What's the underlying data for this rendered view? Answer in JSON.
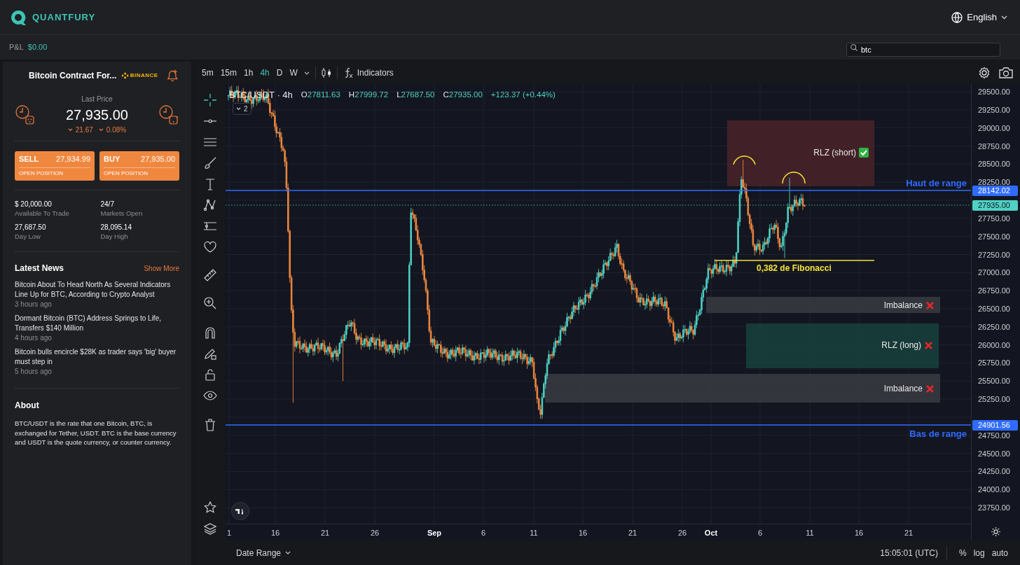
{
  "header": {
    "brand": "QUANTFURY",
    "language": "English"
  },
  "pnl": {
    "label": "P&L",
    "value": "$0.00"
  },
  "search": {
    "value": "btc"
  },
  "instrument": {
    "name": "Bitcoin Contract For...",
    "exchange": "BINANCE",
    "price_label": "Last Price",
    "price": "27,935.00",
    "change": "21.67",
    "change_pct": "0.08%",
    "falling": true
  },
  "trade_buttons": [
    {
      "label": "SELL",
      "price": "27,934.99",
      "action": "OPEN POSITION"
    },
    {
      "label": "BUY",
      "price": "27,935.00",
      "action": "OPEN POSITION"
    }
  ],
  "stats": [
    {
      "value": "$ 20,000.00",
      "label": "Available To Trade"
    },
    {
      "value": "24/7",
      "label": "Markets Open"
    },
    {
      "value": "27,687.50",
      "label": "Day Low"
    },
    {
      "value": "28,095.14",
      "label": "Day High"
    }
  ],
  "news": {
    "title": "Latest News",
    "more": "Show More",
    "items": [
      {
        "headline": "Bitcoin About To Head North As Several Indicators Line Up for BTC, According to Crypto Analyst",
        "time": "3 hours ago"
      },
      {
        "headline": "Dormant Bitcoin (BTC) Address Springs to Life, Transfers $140 Million",
        "time": "4 hours ago"
      },
      {
        "headline": "Bitcoin bulls encircle $28K as trader says 'big' buyer must step in",
        "time": "5 hours ago"
      }
    ]
  },
  "about": {
    "title": "About",
    "text": "BTC/USDT is the rate that one Bitcoin, BTC, is exchanged for Tether, USDT. BTC is the base currency and USDT is the quote currency, or counter currency."
  },
  "toolbar": {
    "timeframes": [
      {
        "label": "5m",
        "selected": false
      },
      {
        "label": "15m",
        "selected": false
      },
      {
        "label": "1h",
        "selected": false
      },
      {
        "label": "4h",
        "selected": true
      },
      {
        "label": "D",
        "selected": false
      },
      {
        "label": "W",
        "selected": false
      }
    ],
    "indicators": "Indicators"
  },
  "legend": {
    "symbol": "BTC/USDT · 4h",
    "ohlc": [
      {
        "key": "O",
        "value": "27811.63"
      },
      {
        "key": "H",
        "value": "27999.72"
      },
      {
        "key": "L",
        "value": "27687.50"
      },
      {
        "key": "C",
        "value": "27935.00"
      }
    ],
    "change": "+123.37 (+0.44%)",
    "collapsed_count": "2"
  },
  "annotations": [
    {
      "kind": "zone_short",
      "label": "RLZ (short)",
      "confirmed": true
    },
    {
      "kind": "range_line",
      "label": "Haut de range"
    },
    {
      "kind": "fib_line",
      "label": "0,382 de Fibonacci"
    },
    {
      "kind": "imbalance",
      "label": "Imbalance",
      "confirmed": false
    },
    {
      "kind": "zone_long",
      "label": "RLZ (long)",
      "confirmed": false
    },
    {
      "kind": "imbalance",
      "label": "Imbalance",
      "confirmed": false
    },
    {
      "kind": "range_line",
      "label": "Bas de range"
    }
  ],
  "price_axis": {
    "labels": [
      "29500.00",
      "29250.00",
      "29000.00",
      "28750.00",
      "28500.00",
      "28250.00",
      "27750.00",
      "27500.00",
      "27250.00",
      "27000.00",
      "26750.00",
      "26500.00",
      "26250.00",
      "26000.00",
      "25750.00",
      "25500.00",
      "25250.00",
      "24750.00",
      "24500.00",
      "24250.00",
      "24000.00",
      "23750.00"
    ],
    "badges": [
      {
        "kind": "range",
        "value": "28142.02"
      },
      {
        "kind": "last",
        "value": "27935.00"
      },
      {
        "kind": "range",
        "value": "24901.56"
      }
    ]
  },
  "time_axis": [
    {
      "label": "1",
      "kind": "day"
    },
    {
      "label": "16",
      "kind": "day"
    },
    {
      "label": "21",
      "kind": "day"
    },
    {
      "label": "26",
      "kind": "day"
    },
    {
      "label": "Sep",
      "kind": "month"
    },
    {
      "label": "6",
      "kind": "day"
    },
    {
      "label": "11",
      "kind": "day"
    },
    {
      "label": "16",
      "kind": "day"
    },
    {
      "label": "21",
      "kind": "day"
    },
    {
      "label": "26",
      "kind": "day"
    },
    {
      "label": "Oct",
      "kind": "month"
    },
    {
      "label": "6",
      "kind": "day"
    },
    {
      "label": "11",
      "kind": "day"
    },
    {
      "label": "16",
      "kind": "day"
    },
    {
      "label": "21",
      "kind": "day"
    }
  ],
  "bottom_bar": {
    "date_range": "Date Range",
    "time": "15:05:01 (UTC)",
    "options": [
      "%",
      "log",
      "auto"
    ]
  }
}
